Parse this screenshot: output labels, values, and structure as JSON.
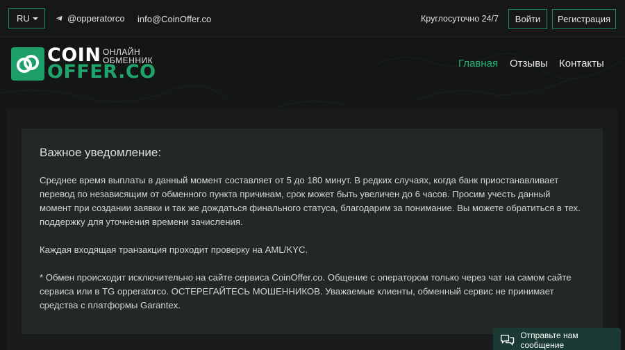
{
  "topbar": {
    "language": "RU",
    "telegram": "@opperatorco",
    "email": "info@CoinOffer.co",
    "hours": "Круглосуточно 24/7",
    "login_label": "Войти",
    "register_label": "Регистрация"
  },
  "logo": {
    "word1": "COIN",
    "word2": "OFFER.CO",
    "tagline1": "ОНЛАЙН",
    "tagline2": "ОБМЕННИК"
  },
  "nav": {
    "home": "Главная",
    "reviews": "Отзывы",
    "contacts": "Контакты"
  },
  "notice": {
    "title": "Важное уведомление:",
    "paragraph1": "Среднее время выплаты в данный момент составляет от 5 до 180 минут. В редких случаях, когда банк приостанавливает перевод по независящим от обменного пункта причинам, срок может быть увеличен до 6 часов. Просим учесть данный момент при создании заявки и так же дождаться финального статуса, благодарим за понимание. Вы можете обратиться в тех. поддержку для уточнения времени зачисления.",
    "paragraph2": "Каждая входящая транзакция проходит проверку на AML/KYC.",
    "paragraph3": "* Обмен происходит исключительно на сайте сервиса CoinOffer.co. Общение с оператором только через чат на самом сайте сервиса или в TG opperatorco. ОСТЕРЕГАЙТЕСЬ МОШЕННИКОВ. Уважаемые клиенты, обменный сервис не принимает средства с платформы Garantex."
  },
  "chat": {
    "label": "Отправьте нам сообщение"
  },
  "colors": {
    "accent": "#1fa56c",
    "background": "#141515",
    "panel": "#222826"
  },
  "icons": [
    "telegram-icon",
    "caret-down-icon",
    "chat-bubble-icon",
    "logo-mark-icon"
  ]
}
